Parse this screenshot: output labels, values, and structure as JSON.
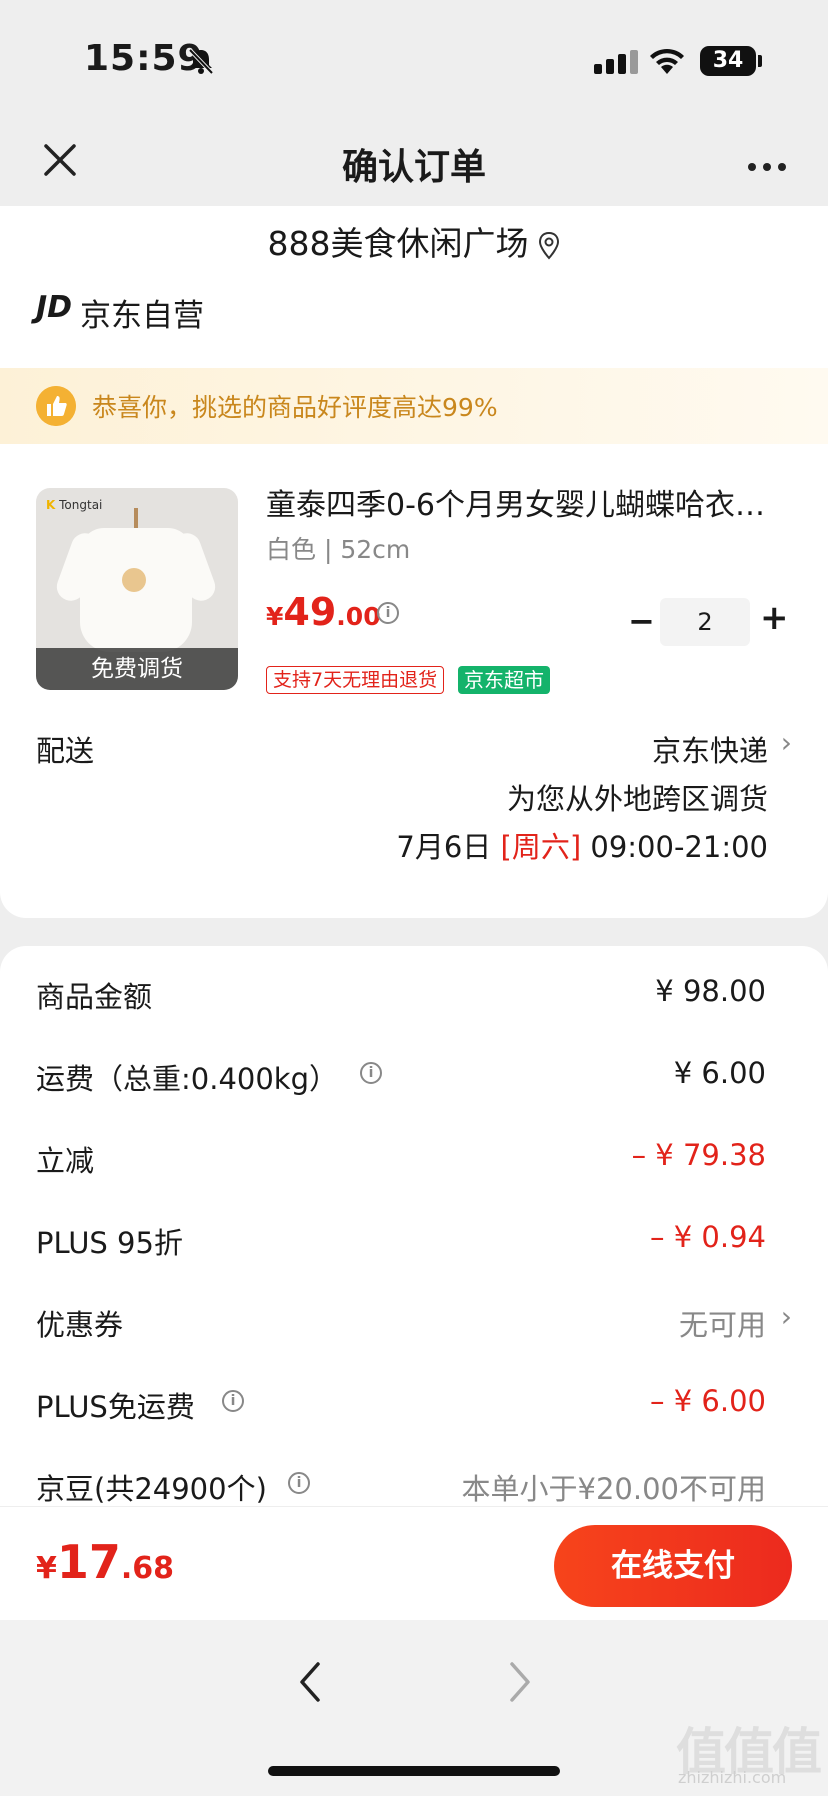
{
  "status_bar": {
    "time": "15:59",
    "battery": "34"
  },
  "nav": {
    "title": "确认订单"
  },
  "store": {
    "name": "888美食休闲广场"
  },
  "seller": {
    "logo": "JD",
    "name": "京东自营"
  },
  "praise": {
    "text": "恭喜你，挑选的商品好评度高达99%"
  },
  "product": {
    "brand": "Tongtai",
    "thumb_label": "免费调货",
    "title": "童泰四季0-6个月男女婴儿蝴蝶哈衣…",
    "spec": "白色 | 52cm",
    "price_currency": "¥",
    "price_int": "49",
    "price_dec": ".00",
    "quantity": "2",
    "minus": "−",
    "plus": "+",
    "tag_return": "支持7天无理由退货",
    "tag_market": "京东超市"
  },
  "shipping": {
    "label": "配送",
    "method": "京东快递",
    "note": "为您从外地跨区调货",
    "date": "7月6日",
    "weekday": "[周六]",
    "time_range": "09:00-21:00"
  },
  "summary": {
    "goods_label": "商品金额",
    "goods_value": "¥ 98.00",
    "freight_label": "运费（总重:0.400kg）",
    "freight_value": "¥ 6.00",
    "discount_label": "立减",
    "discount_value": "– ¥ 79.38",
    "plus_label": "PLUS 95折",
    "plus_value": "– ¥ 0.94",
    "coupon_label": "优惠券",
    "coupon_value": "无可用",
    "plus_free_label": "PLUS免运费",
    "plus_free_value": "– ¥ 6.00",
    "beans_label": "京豆(共24900个)",
    "beans_value": "本单小于¥20.00不可用"
  },
  "footer": {
    "total_currency": "¥",
    "total_int": "17",
    "total_dec": ".68",
    "pay_button": "在线支付"
  },
  "watermark": {
    "text": "值值值",
    "sub": "zhizhizhi.com"
  },
  "colors": {
    "accent_red": "#e2231a",
    "green_tag": "#14b36b",
    "praise_text": "#c9871d"
  }
}
